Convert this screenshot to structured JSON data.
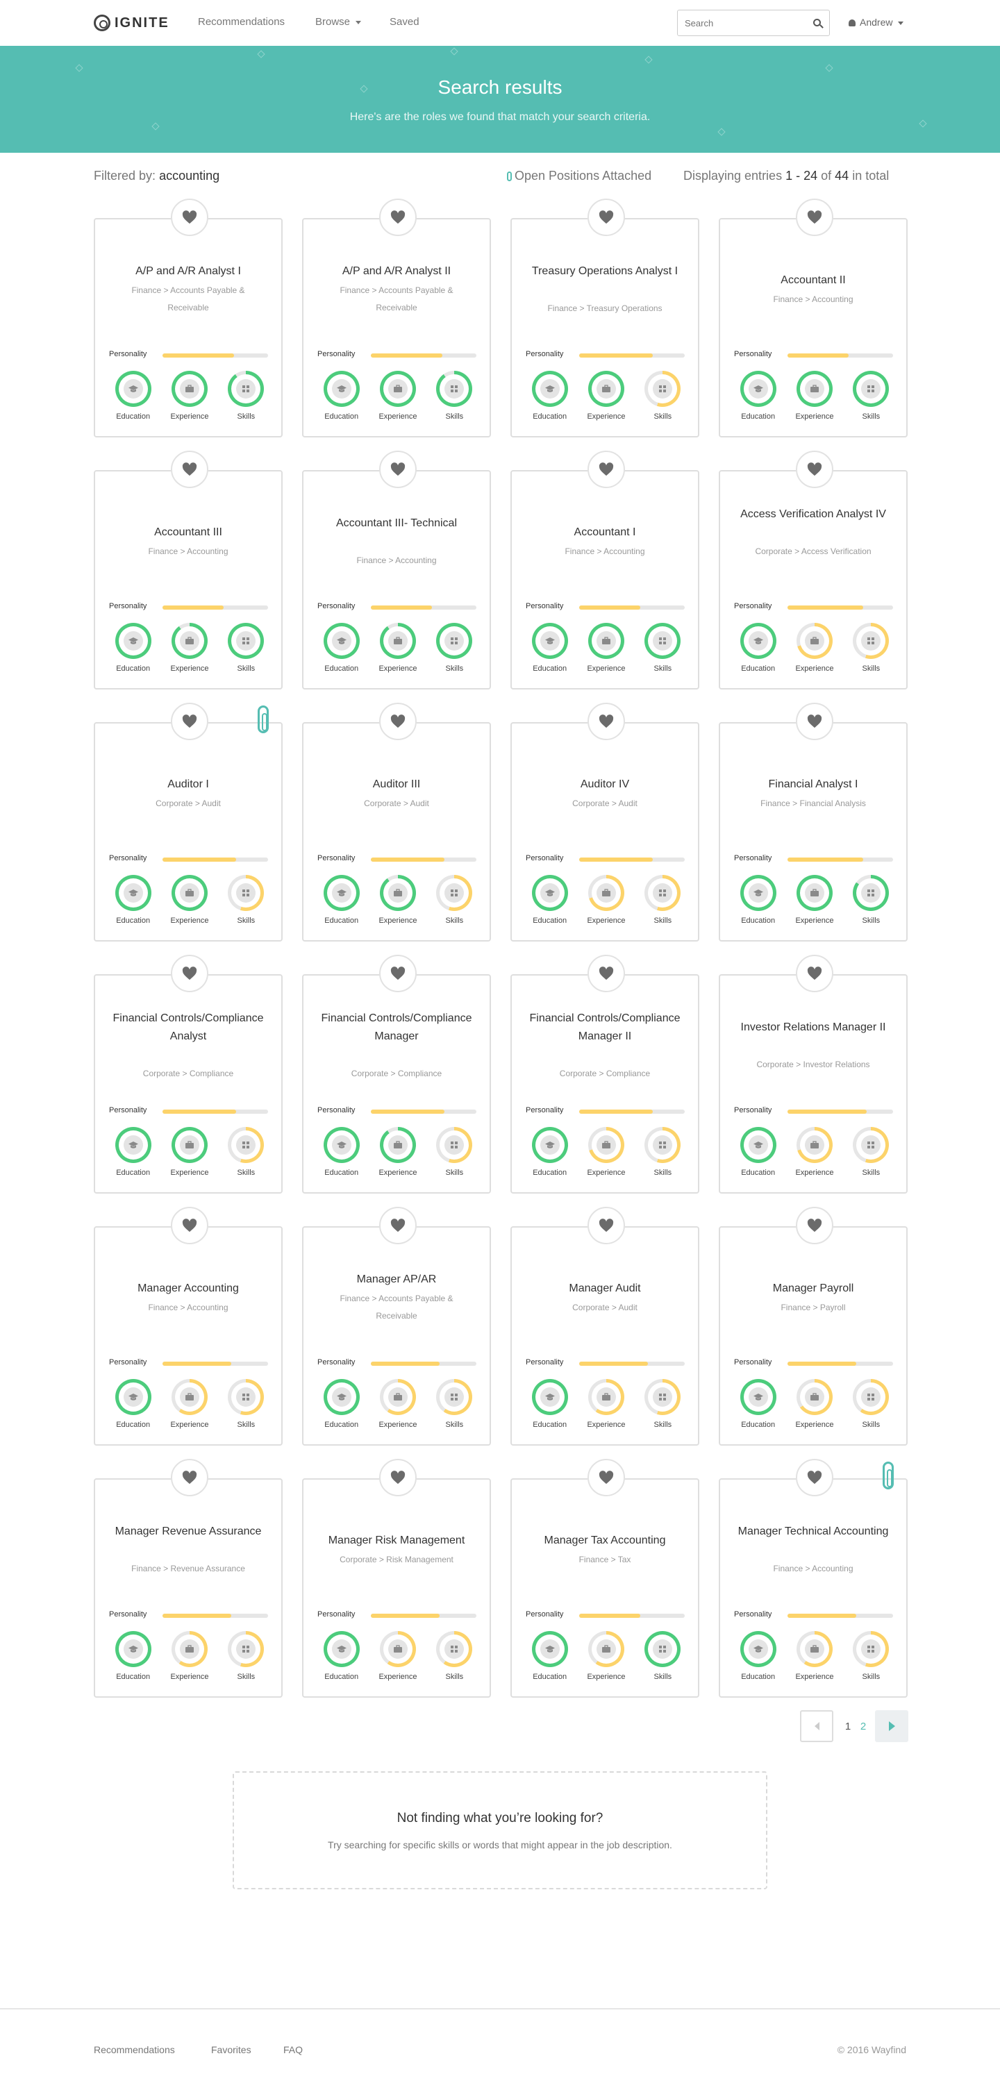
{
  "brand": {
    "name": "IGNITE"
  },
  "nav": {
    "recommendations": "Recommendations",
    "browse": "Browse",
    "saved": "Saved",
    "search_placeholder": "Search",
    "user": "Andrew"
  },
  "hero": {
    "title": "Search results",
    "subtitle": "Here's are the roles we found that match your search criteria."
  },
  "filter": {
    "label": "Filtered by:",
    "value": "accounting"
  },
  "open_positions": "Open Positions Attached",
  "entries": {
    "prefix": "Displaying entries",
    "range": "1 - 24",
    "of": "of",
    "total": "44",
    "suffix": "in total"
  },
  "labels": {
    "personality": "Personality",
    "education": "Education",
    "experience": "Experience",
    "skills": "Skills"
  },
  "colors": {
    "accent": "#55bdb2",
    "green": "#4ccc7c",
    "yellow": "#fcd36a",
    "track": "#e6e6e6"
  },
  "roles": [
    {
      "title": "A/P and A/R Analyst I",
      "category": "Finance > Accounts Payable & Receivable",
      "personality": 0.68,
      "education": 1,
      "experience": 1,
      "skills": 0.9,
      "attached": false
    },
    {
      "title": "A/P and A/R Analyst II",
      "category": "Finance > Accounts Payable & Receivable",
      "personality": 0.68,
      "education": 1,
      "experience": 1,
      "skills": 0.9,
      "attached": false
    },
    {
      "title": "Treasury Operations Analyst I",
      "category": "Finance > Treasury Operations",
      "personality": 0.7,
      "education": 1,
      "experience": 1,
      "skills": 0.55,
      "attached": false
    },
    {
      "title": "Accountant II",
      "category": "Finance > Accounting",
      "personality": 0.58,
      "education": 1,
      "experience": 1,
      "skills": 1,
      "attached": false
    },
    {
      "title": "Accountant III",
      "category": "Finance > Accounting",
      "personality": 0.58,
      "education": 1,
      "experience": 0.9,
      "skills": 1,
      "attached": false
    },
    {
      "title": "Accountant III- Technical",
      "category": "Finance > Accounting",
      "personality": 0.58,
      "education": 1,
      "experience": 0.9,
      "skills": 1,
      "attached": false
    },
    {
      "title": "Accountant I",
      "category": "Finance > Accounting",
      "personality": 0.58,
      "education": 1,
      "experience": 1,
      "skills": 1,
      "attached": false
    },
    {
      "title": "Access Verification Analyst IV",
      "category": "Corporate > Access Verification",
      "personality": 0.72,
      "education": 1,
      "experience": 0.7,
      "skills": 0.55,
      "attached": false
    },
    {
      "title": "Auditor I",
      "category": "Corporate > Audit",
      "personality": 0.7,
      "education": 1,
      "experience": 1,
      "skills": 0.55,
      "attached": true
    },
    {
      "title": "Auditor III",
      "category": "Corporate > Audit",
      "personality": 0.7,
      "education": 1,
      "experience": 0.9,
      "skills": 0.55,
      "attached": false
    },
    {
      "title": "Auditor IV",
      "category": "Corporate > Audit",
      "personality": 0.7,
      "education": 1,
      "experience": 0.7,
      "skills": 0.55,
      "attached": false
    },
    {
      "title": "Financial Analyst I",
      "category": "Finance > Financial Analysis",
      "personality": 0.72,
      "education": 1,
      "experience": 1,
      "skills": 0.85,
      "attached": false
    },
    {
      "title": "Financial Controls/Compliance Analyst",
      "category": "Corporate > Compliance",
      "personality": 0.7,
      "education": 1,
      "experience": 1,
      "skills": 0.55,
      "attached": false
    },
    {
      "title": "Financial Controls/Compliance Manager",
      "category": "Corporate > Compliance",
      "personality": 0.7,
      "education": 1,
      "experience": 0.9,
      "skills": 0.55,
      "attached": false
    },
    {
      "title": "Financial Controls/Compliance Manager II",
      "category": "Corporate > Compliance",
      "personality": 0.7,
      "education": 1,
      "experience": 0.7,
      "skills": 0.55,
      "attached": false
    },
    {
      "title": "Investor Relations Manager II",
      "category": "Corporate > Investor Relations",
      "personality": 0.75,
      "education": 1,
      "experience": 0.7,
      "skills": 0.55,
      "attached": false
    },
    {
      "title": "Manager Accounting",
      "category": "Finance > Accounting",
      "personality": 0.65,
      "education": 1,
      "experience": 0.6,
      "skills": 0.55,
      "attached": false
    },
    {
      "title": "Manager AP/AR",
      "category": "Finance > Accounts Payable & Receivable",
      "personality": 0.65,
      "education": 1,
      "experience": 0.6,
      "skills": 0.6,
      "attached": false
    },
    {
      "title": "Manager Audit",
      "category": "Corporate > Audit",
      "personality": 0.65,
      "education": 1,
      "experience": 0.6,
      "skills": 0.55,
      "attached": false
    },
    {
      "title": "Manager Payroll",
      "category": "Finance > Payroll",
      "personality": 0.65,
      "education": 1,
      "experience": 0.65,
      "skills": 0.6,
      "attached": false
    },
    {
      "title": "Manager Revenue Assurance",
      "category": "Finance > Revenue Assurance",
      "personality": 0.65,
      "education": 1,
      "experience": 0.6,
      "skills": 0.55,
      "attached": false
    },
    {
      "title": "Manager Risk Management",
      "category": "Corporate > Risk Management",
      "personality": 0.65,
      "education": 1,
      "experience": 0.6,
      "skills": 0.6,
      "attached": false
    },
    {
      "title": "Manager Tax Accounting",
      "category": "Finance > Tax",
      "personality": 0.58,
      "education": 1,
      "experience": 0.6,
      "skills": 1,
      "attached": false
    },
    {
      "title": "Manager Technical Accounting",
      "category": "Finance > Accounting",
      "personality": 0.65,
      "education": 1,
      "experience": 0.6,
      "skills": 0.55,
      "attached": true
    }
  ],
  "pagination": {
    "pages": [
      "1",
      "2"
    ],
    "current": "1"
  },
  "not_found": {
    "title": "Not finding what you’re looking for?",
    "text": "Try searching for specific skills or words that might appear in the job description."
  },
  "footer": {
    "links": [
      "Recommendations",
      "Favorites",
      "FAQ"
    ],
    "copyright": "© 2016 Wayfind"
  }
}
